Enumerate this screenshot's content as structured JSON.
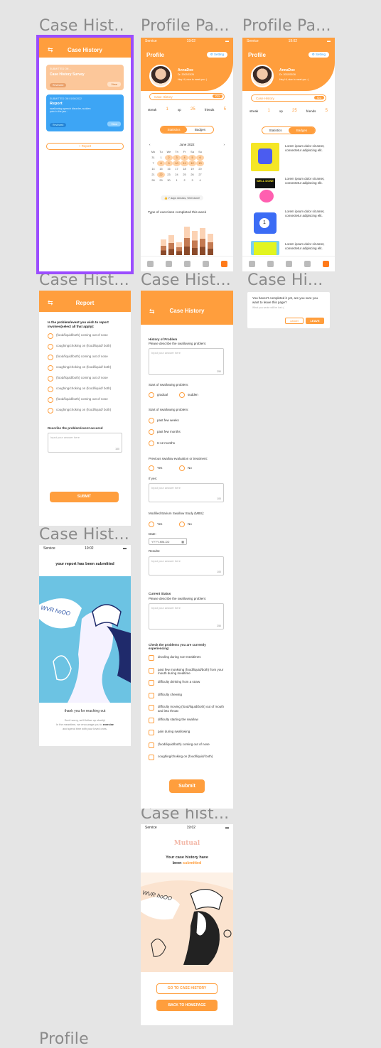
{
  "frames": {
    "case_history_1": "Case Hist...",
    "profile_1": "Profile Pa...",
    "profile_2": "Profile Pa...",
    "report": "Case Hist...",
    "form": "Case Hist...",
    "leave_dialog": "Case Hi...",
    "submitted": "Case Hist...",
    "completed": "Case hist...",
    "profile_bottom": "Profile"
  },
  "status": {
    "carrier": "Service",
    "time": "19:02"
  },
  "case_history": {
    "title": "Case History",
    "card1_meta": "SUBMITTED ON ...",
    "card1_title": "Case History Survey",
    "card1_status": "Reviewed",
    "card1_action": "View",
    "card2_meta": "SUBMITTED ON 01/06/2022",
    "card2_title": "Report",
    "card2_desc": "swallowing speech disorder, sudden pain in the jaw...",
    "card2_status": "Reviewed",
    "card2_action": "View",
    "add_report": "+ Report"
  },
  "profile": {
    "title": "Profile",
    "setting": "Setting",
    "name": "AnnaDoe",
    "dob": "Dr. 2002/03/26",
    "greet": "Hey Hi, nice to meet you :)",
    "case_btn_label": "Case History",
    "go": "Go",
    "streak_label": "streak",
    "streak": "1",
    "xp_label": "xp",
    "xp": "25",
    "friends_label": "friends",
    "friends": "5",
    "tab_stats": "Statistics",
    "tab_badges": "Badges",
    "month": "June 2022",
    "weekdays": [
      "Mo",
      "Tu",
      "We",
      "Th",
      "Fr",
      "Sa",
      "Su"
    ],
    "streak_note": "7 days streaks, Well done!",
    "chart_title": "Type of exercises completed this week",
    "badge_text": "Lorem ipsum dolor sit amet, consectetur adipiscing elit.",
    "badge_label": "WELL DONE"
  },
  "report": {
    "title": "Report",
    "question": "Is the problem/event you wish to report involves(select all that apply):",
    "options": [
      "(food/liquid/both) coming out of nose",
      "coughing/choking on (food/liquid/ both)",
      "(food/liquid/both) coming out of nose",
      "coughing/choking on (food/liquid/ both)",
      "(food/liquid/both) coming out of nose",
      "coughing/choking on (food/liquid/ both)",
      "(food/liquid/both) coming out of nose",
      "coughing/choking on (food/liquid/ both)"
    ],
    "describe_label": "Describe the problem/event accured",
    "placeholder": "Input your answer here",
    "count": "100",
    "submit": "SUBMIT"
  },
  "form": {
    "title": "Case History",
    "hist_head": "History of Problem",
    "hist_desc": "Please describe the swallowing problem:",
    "placeholder": "Input your answer here",
    "count1": "250",
    "start_label": "Start of swallowing problem:",
    "gradual": "gradual",
    "sudden": "sudden",
    "start_label2": "Start of swallowing problem:",
    "weeks": "past few weeks",
    "months": "past few months",
    "m612": "6-12 months",
    "prev_label": "Previous swallow evaluation or treatment:",
    "yes": "Yes",
    "no": "No",
    "ifyes": "If yes:",
    "count2": "100",
    "mbs_label": "Modified Barium Swallow Study (MBS):",
    "date_label": "Date:",
    "date_ph": "YYYY-MM-DD",
    "results_label": "Results:",
    "count3": "100",
    "current_head": "Current Status",
    "current_desc": "Please describe the swallowing problem:",
    "count4": "250",
    "check_head": "Check the problems you are currently experiencing:",
    "checks": [
      "drooling during non-mealtimes",
      "past few monksing (food/liquid/both) from your mouth during mealtime",
      "difficulty drinking from a straw",
      "difficulty chewing",
      "difficulty moving (food/liquid/both) out of mouth and into throat",
      "difficulty starting the swallow",
      "pain during swallowing",
      "(food/liquid/both) coming out of nose",
      "coughing/choking on (food/liquid/ both)"
    ],
    "submit": "Submit"
  },
  "dialog": {
    "text": "You haven't completed it yet, are you sure you want to leave this page?",
    "sub": "What you wrote will be lost :(",
    "cancel": "cancel",
    "leave": "LEAVE"
  },
  "submitted": {
    "headline": "your report has been submitted",
    "thanks": "thank you for reaching out",
    "sub1": "Don't worry, we'll follow up shortly!",
    "sub2a": "In the meantime, we encourage you to ",
    "sub2b": "exercise",
    "sub3": "and spend time with your loved ones.",
    "scribble": "WVR hoOO"
  },
  "completed": {
    "logo": "Mutual",
    "line1": "Your case history have",
    "line2a": "been ",
    "line2b": "submitted",
    "btn1": "GO TO CASE HISTORY",
    "btn2": "BACK TO HOMEPAGE",
    "scribble": "WVR hoOO"
  }
}
